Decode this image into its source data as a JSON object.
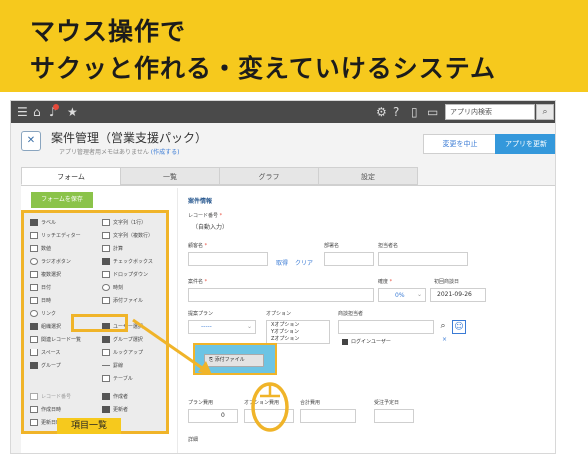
{
  "banner": {
    "line1": "マウス操作で",
    "line2": "サクッと作れる・変えていけるシステム"
  },
  "topbar": {
    "icons": [
      "menu-icon",
      "home-icon",
      "bell-icon",
      "star-icon",
      "gear-icon",
      "help-icon",
      "mobile-icon",
      "id-icon"
    ],
    "search_placeholder": "アプリ内検索",
    "search_icon": "search-icon"
  },
  "app": {
    "title": "案件管理（営業支援パック）",
    "memo": "アプリ管理者用メモはありません",
    "memo_link": "(作成する)",
    "btn_stop": "変更を中止",
    "btn_update": "アプリを更新"
  },
  "tabs": [
    "フォーム",
    "一覧",
    "グラフ",
    "設定"
  ],
  "palette": {
    "save_button": "フォームを保存",
    "label": "項目一覧",
    "items_left": [
      "ラベル",
      "リッチエディター",
      "数値",
      "ラジオボタン",
      "複数選択",
      "日付",
      "日時",
      "リンク",
      "組織選択",
      "関連レコード一覧",
      "スペース",
      "グループ"
    ],
    "items_right": [
      "文字列（1行）",
      "文字列（複数行）",
      "計算",
      "チェックボックス",
      "ドロップダウン",
      "時刻",
      "添付ファイル",
      "ユーザー選択",
      "グループ選択",
      "ルックアップ",
      "罫線",
      "テーブル"
    ],
    "system_left": [
      "レコード番号",
      "作成日時",
      "更新日時"
    ],
    "system_right": [
      "作成者",
      "更新者"
    ]
  },
  "form": {
    "section_title": "案件情報",
    "record_no_label": "レコード番号",
    "record_no_value": "（自動入力）",
    "client_label": "顧客名",
    "dept_label": "部署名",
    "person_label": "担当者名",
    "fetch_link": "取得",
    "clear_link": "クリア",
    "deal_label": "案件名",
    "certainty_label": "確度",
    "certainty_value": "0%",
    "first_date_label": "初回商談日",
    "first_date_value": "2021-09-26",
    "plan_label": "提案プラン",
    "plan_value": "-----",
    "option_label": "オプション",
    "options": [
      "Xオプション",
      "Yオプション",
      "Zオプション"
    ],
    "owner_label": "商談担当者",
    "owner_value": "ログインユーザー",
    "dragged_item": "添付ファイル",
    "plan_fee_label": "プラン費用",
    "plan_fee_value": "0",
    "option_fee_label": "オプション費用",
    "total_label": "合計費用",
    "order_date_label": "受注予定日",
    "detail_label": "詳細"
  },
  "colors": {
    "banner": "#f6c91d",
    "highlight": "#f0b429",
    "accent": "#3498db",
    "dropzone": "#6cc4e4",
    "save": "#8bc34a"
  }
}
